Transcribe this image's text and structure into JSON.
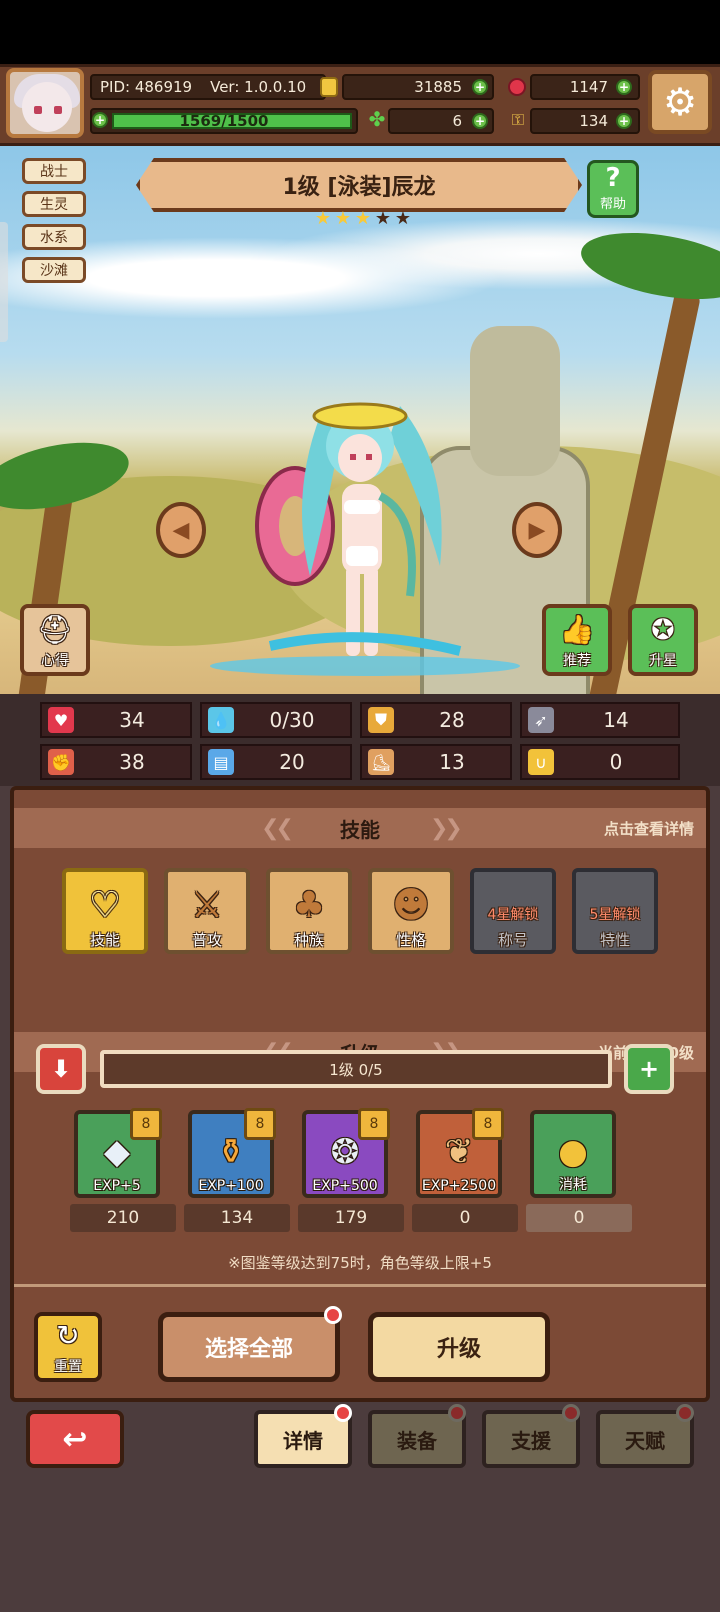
{
  "header": {
    "pid": "PID: 486919",
    "version": "Ver: 1.0.0.10",
    "gold": "31885",
    "gems": "1147",
    "stamina": "1569/1500",
    "clovers": "6",
    "keys": "134",
    "gear_icon": "gear-icon"
  },
  "tags": [
    "战士",
    "生灵",
    "水系",
    "沙滩"
  ],
  "character": {
    "title": "1级  [泳装]辰龙",
    "stars_filled": 3,
    "stars_total": 5,
    "help_label": "帮助"
  },
  "side_buttons": {
    "left": "心得",
    "recommend": "推荐",
    "star_up": "升星"
  },
  "stats": [
    {
      "icon": "heart-icon",
      "value": "34",
      "color": "#e2384d"
    },
    {
      "icon": "drop-icon",
      "value": "0/30",
      "color": "#5bc6e8"
    },
    {
      "icon": "shield-icon",
      "value": "28",
      "color": "#e8a93a"
    },
    {
      "icon": "wing-icon",
      "value": "14",
      "color": "#e8e8f0"
    },
    {
      "icon": "fist-icon",
      "value": "38",
      "color": "#e0604a"
    },
    {
      "icon": "book-icon",
      "value": "20",
      "color": "#5aa8e8"
    },
    {
      "icon": "boot-icon",
      "value": "13",
      "color": "#e0a060"
    },
    {
      "icon": "magnet-icon",
      "value": "0",
      "color": "#f2c23a"
    }
  ],
  "skills_section": {
    "title": "技能",
    "hint": "点击查看详情",
    "items": [
      {
        "label": "技能",
        "icon": "heart-shield-icon",
        "locked": "",
        "color": "#f0c23a"
      },
      {
        "label": "普攻",
        "icon": "sword-icon",
        "locked": "",
        "color": "#e0b070"
      },
      {
        "label": "种族",
        "icon": "creature-icon",
        "locked": "",
        "color": "#e0b070"
      },
      {
        "label": "性格",
        "icon": "mask-icon",
        "locked": "",
        "color": "#e0b070"
      },
      {
        "label": "称号",
        "icon": "lock-icon",
        "locked": "4星解锁",
        "color": "#5a5a60"
      },
      {
        "label": "特性",
        "icon": "lock-icon",
        "locked": "5星解锁",
        "color": "#5a5a60"
      }
    ]
  },
  "upgrade_section": {
    "title": "升级",
    "hint": "当前上限80级",
    "level_text": "1级  0/5",
    "items": [
      {
        "label": "EXP+5",
        "count": "210",
        "badge": "8",
        "color": "#4aa05a",
        "icon": "crystal-icon"
      },
      {
        "label": "EXP+100",
        "count": "134",
        "badge": "8",
        "color": "#3f7fc0",
        "icon": "potion-icon"
      },
      {
        "label": "EXP+500",
        "count": "179",
        "badge": "8",
        "color": "#8a4ac0",
        "icon": "fish-icon"
      },
      {
        "label": "EXP+2500",
        "count": "0",
        "badge": "8",
        "color": "#c0603a",
        "icon": "roast-icon"
      },
      {
        "label": "消耗",
        "count": "0",
        "badge": "",
        "color": "#4aa05a",
        "icon": "coin-icon"
      }
    ],
    "note": "※图鉴等级达到75时，角色等级上限+5"
  },
  "actions": {
    "reset": "重置",
    "select_all": "选择全部",
    "upgrade": "升级"
  },
  "bottom_tabs": [
    "详情",
    "装备",
    "支援",
    "天赋"
  ]
}
